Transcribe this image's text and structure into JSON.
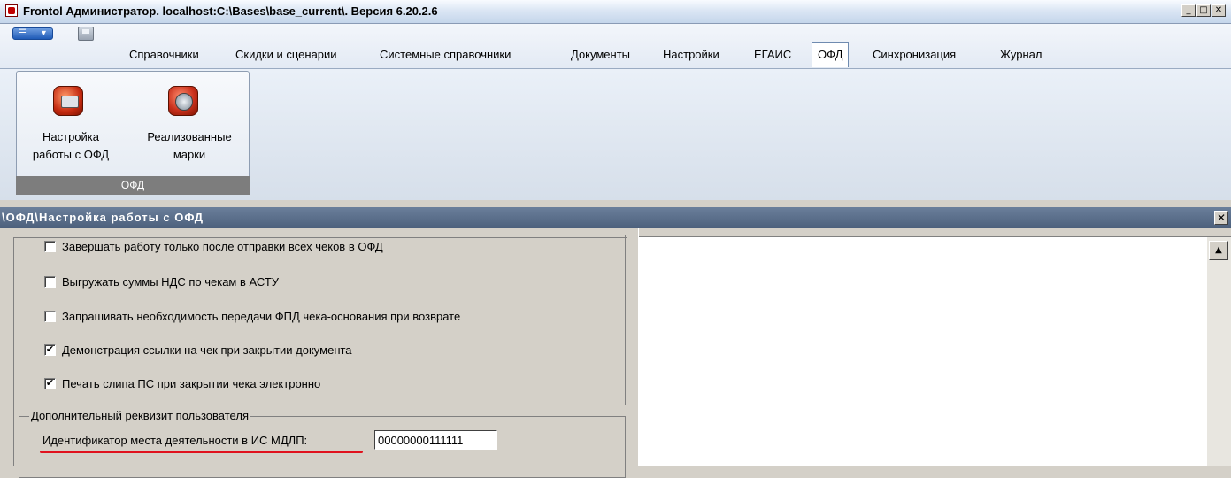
{
  "window": {
    "title": "Frontol Администратор. localhost:C:\\Bases\\base_current\\. Версия 6.20.2.6",
    "minimize_icon": "minimize-icon",
    "maximize_icon": "maximize-icon",
    "close_icon": "close-icon"
  },
  "menu": {
    "items": [
      "Справочники",
      "Скидки и сценарии",
      "Системные справочники",
      "Документы",
      "Настройки",
      "ЕГАИС",
      "ОФД",
      "Синхронизация",
      "Журнал"
    ],
    "active": "ОФД"
  },
  "ribbon": {
    "group_label": "ОФД",
    "buttons": [
      {
        "label_line1": "Настройка",
        "label_line2": "работы с ОФД",
        "icon": "ofd-settings-icon"
      },
      {
        "label_line1": "Реализованные",
        "label_line2": "марки",
        "icon": "marks-icon"
      }
    ]
  },
  "document": {
    "title": "\\ОФД\\Настройка работы с ОФД",
    "close_icon": "close-icon"
  },
  "options": [
    {
      "label": "Завершать работу только после отправки всех чеков в ОФД",
      "checked": false
    },
    {
      "label": "Выгружать суммы НДС по чекам в АСТУ",
      "checked": false
    },
    {
      "label": "Запрашивать необходимость передачи ФПД чека-основания при возврате",
      "checked": false
    },
    {
      "label": "Демонстрация ссылки на чек при закрытии документа",
      "checked": true
    },
    {
      "label": "Печать слипа ПС при закрытии чека электронно",
      "checked": true
    }
  ],
  "user_requisite": {
    "legend": "Дополнительный реквизит пользователя",
    "field_label": "Идентификатор места деятельности в ИС МДЛП:",
    "field_value": "00000000111111"
  },
  "colors": {
    "highlight_underline": "#e0121e",
    "doc_header": "#5a6e8a"
  }
}
